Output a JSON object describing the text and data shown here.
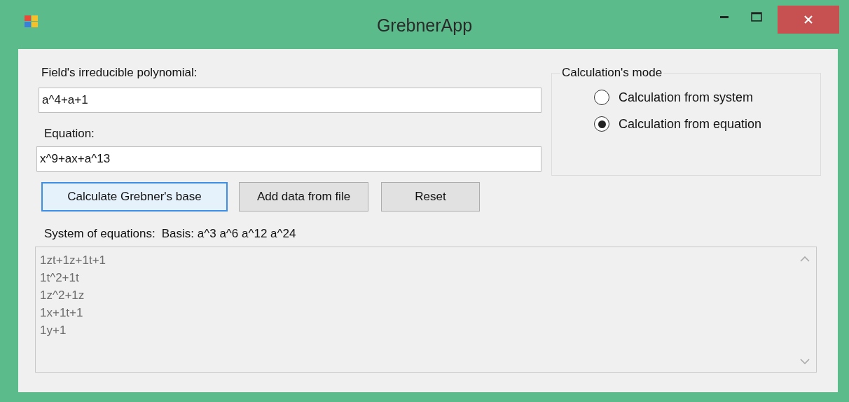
{
  "window": {
    "title": "GrebnerApp"
  },
  "fields": [
    {
      "label": "Field's irreducible polynomial:",
      "value": "a^4+a+1"
    },
    {
      "label": "Equation:",
      "value": "x^9+ax+a^13"
    }
  ],
  "buttons": [
    {
      "label": "Calculate Grebner's base",
      "focused": true
    },
    {
      "label": "Add data from file",
      "focused": false
    },
    {
      "label": "Reset",
      "focused": false
    }
  ],
  "mode_group": {
    "title": "Calculation's mode",
    "options": [
      {
        "label": "Calculation from system",
        "selected": false
      },
      {
        "label": "Calculation from equation",
        "selected": true
      }
    ]
  },
  "system_label": "System of equations:",
  "basis_label": "Basis: a^3 a^6 a^12 a^24",
  "output": {
    "lines": [
      "1zt+1z+1t+1",
      "1t^2+1t",
      "1z^2+1z",
      "1x+1t+1",
      "1y+1"
    ]
  }
}
